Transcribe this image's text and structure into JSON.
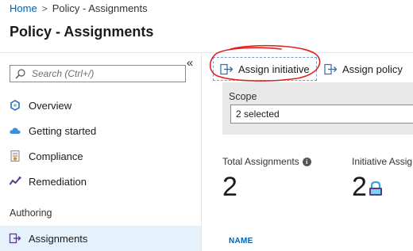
{
  "breadcrumb": {
    "home": "Home",
    "separator": ">",
    "current": "Policy - Assignments"
  },
  "page": {
    "title": "Policy - Assignments"
  },
  "sidebar": {
    "collapse_glyph": "«",
    "search_placeholder": "Search (Ctrl+/)",
    "items": [
      {
        "label": "Overview",
        "icon": "overview-icon"
      },
      {
        "label": "Getting started",
        "icon": "cloud-icon"
      },
      {
        "label": "Compliance",
        "icon": "compliance-icon"
      },
      {
        "label": "Remediation",
        "icon": "remediation-icon"
      }
    ],
    "section_header": "Authoring",
    "active_item": {
      "label": "Assignments",
      "icon": "assignments-icon"
    }
  },
  "toolbar": {
    "assign_initiative": "Assign initiative",
    "assign_policy": "Assign policy"
  },
  "scope": {
    "label": "Scope",
    "value": "2 selected"
  },
  "stats": {
    "total_label": "Total Assignments",
    "total_value": "2",
    "initiative_label": "Initiative Assig",
    "initiative_value": "2"
  },
  "table": {
    "name_header": "NAME"
  },
  "colors": {
    "accent": "#0063b1",
    "annotation": "#e0201b",
    "active_bg": "#e6f2fb"
  }
}
